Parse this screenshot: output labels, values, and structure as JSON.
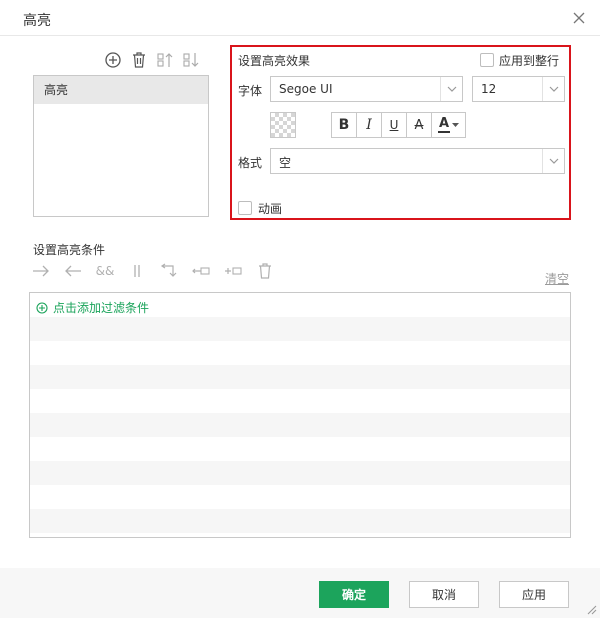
{
  "dialog": {
    "title": "高亮"
  },
  "list": {
    "items": [
      {
        "label": "高亮"
      }
    ]
  },
  "effect": {
    "title": "设置高亮效果",
    "apply_whole_row_label": "应用到整行",
    "font_label": "字体",
    "font_value": "Segoe UI",
    "size_value": "12",
    "bold": "B",
    "italic": "I",
    "underline": "U",
    "strike": "A",
    "font_color": "A",
    "format_label": "格式",
    "format_value": "空",
    "animation_label": "动画"
  },
  "conditions": {
    "title": "设置高亮条件",
    "clear_label": "清空",
    "add_label": "点击添加过滤条件"
  },
  "footer": {
    "ok_label": "确定",
    "cancel_label": "取消",
    "apply_label": "应用"
  },
  "colors": {
    "accent": "#1ca45c",
    "highlight_border": "#d9141b",
    "font_color_bar": "#333333"
  }
}
